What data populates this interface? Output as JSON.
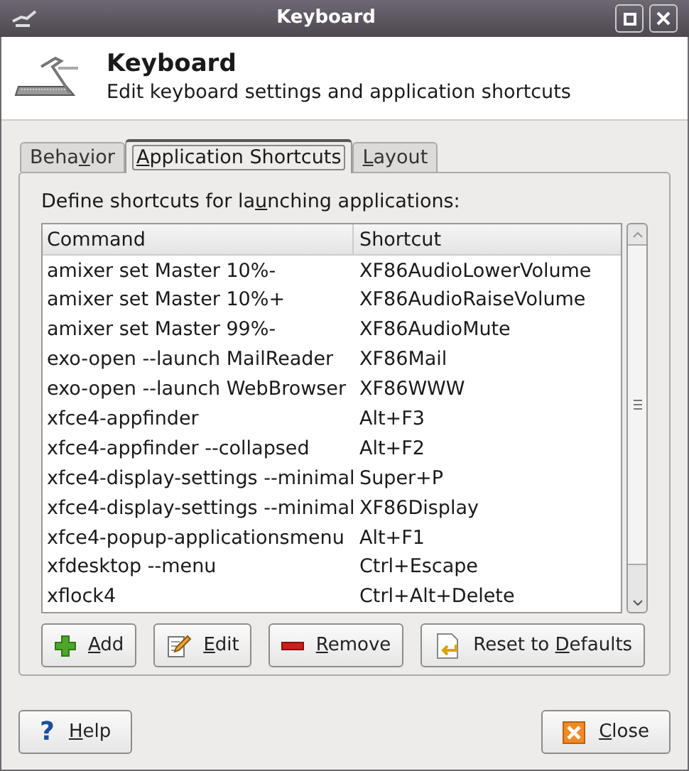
{
  "window": {
    "title": "Keyboard"
  },
  "header": {
    "title": "Keyboard",
    "subtitle": "Edit keyboard settings and application shortcuts"
  },
  "tabs": [
    {
      "pre": "Beha",
      "key": "v",
      "post": "ior",
      "selected": false
    },
    {
      "key": "A",
      "post": "pplication Shortcuts",
      "selected": true
    },
    {
      "key": "L",
      "post": "ayout",
      "selected": false
    }
  ],
  "intro": {
    "pre": "Define shortcuts for la",
    "key": "u",
    "post": "nching applications:"
  },
  "table": {
    "columns": [
      "Command",
      "Shortcut"
    ],
    "rows": [
      [
        "amixer set Master 10%-",
        "XF86AudioLowerVolume"
      ],
      [
        "amixer set Master 10%+",
        "XF86AudioRaiseVolume"
      ],
      [
        "amixer set Master 99%-",
        "XF86AudioMute"
      ],
      [
        "exo-open --launch MailReader",
        "XF86Mail"
      ],
      [
        "exo-open --launch WebBrowser",
        "XF86WWW"
      ],
      [
        "xfce4-appfinder",
        "Alt+F3"
      ],
      [
        "xfce4-appfinder --collapsed",
        "Alt+F2"
      ],
      [
        "xfce4-display-settings --minimal",
        "Super+P"
      ],
      [
        "xfce4-display-settings --minimal",
        "XF86Display"
      ],
      [
        "xfce4-popup-applicationsmenu",
        "Alt+F1"
      ],
      [
        "xfdesktop --menu",
        "Ctrl+Escape"
      ],
      [
        "xflock4",
        "Ctrl+Alt+Delete"
      ]
    ]
  },
  "actions": [
    {
      "kind": "add",
      "key": "A",
      "post": "dd"
    },
    {
      "kind": "edit",
      "key": "E",
      "post": "dit"
    },
    {
      "kind": "remove",
      "key": "R",
      "post": "emove"
    },
    {
      "kind": "reset",
      "pre": "Reset to ",
      "key": "D",
      "post": "efaults"
    }
  ],
  "footer": [
    {
      "kind": "help",
      "icon": "?",
      "key": "H",
      "post": "elp"
    },
    {
      "kind": "close",
      "key": "C",
      "post": "lose"
    }
  ]
}
